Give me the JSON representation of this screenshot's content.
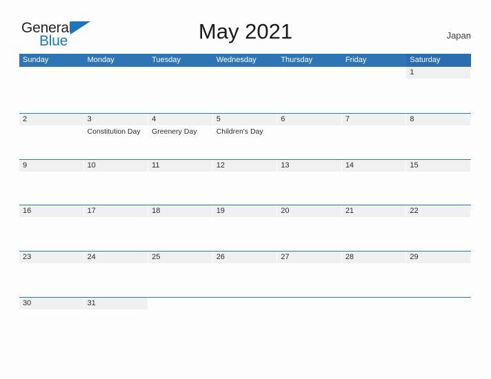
{
  "brand": {
    "word_one": "General",
    "word_two": "Blue"
  },
  "header": {
    "title": "May 2021",
    "country": "Japan"
  },
  "calendar": {
    "weekday_headers": [
      "Sunday",
      "Monday",
      "Tuesday",
      "Wednesday",
      "Thursday",
      "Friday",
      "Saturday"
    ],
    "colors": {
      "header_blue": "#2e75b6",
      "saturday_blue": "#2a6db0",
      "row_rule": "#2e75b6",
      "day_band": "#f0f0f0",
      "brand_blue": "#1c76bc"
    },
    "weeks": [
      [
        {
          "day": "",
          "event": ""
        },
        {
          "day": "",
          "event": ""
        },
        {
          "day": "",
          "event": ""
        },
        {
          "day": "",
          "event": ""
        },
        {
          "day": "",
          "event": ""
        },
        {
          "day": "",
          "event": ""
        },
        {
          "day": "1",
          "event": ""
        }
      ],
      [
        {
          "day": "2",
          "event": ""
        },
        {
          "day": "3",
          "event": "Constitution Day"
        },
        {
          "day": "4",
          "event": "Greenery Day"
        },
        {
          "day": "5",
          "event": "Children's Day"
        },
        {
          "day": "6",
          "event": ""
        },
        {
          "day": "7",
          "event": ""
        },
        {
          "day": "8",
          "event": ""
        }
      ],
      [
        {
          "day": "9",
          "event": ""
        },
        {
          "day": "10",
          "event": ""
        },
        {
          "day": "11",
          "event": ""
        },
        {
          "day": "12",
          "event": ""
        },
        {
          "day": "13",
          "event": ""
        },
        {
          "day": "14",
          "event": ""
        },
        {
          "day": "15",
          "event": ""
        }
      ],
      [
        {
          "day": "16",
          "event": ""
        },
        {
          "day": "17",
          "event": ""
        },
        {
          "day": "18",
          "event": ""
        },
        {
          "day": "19",
          "event": ""
        },
        {
          "day": "20",
          "event": ""
        },
        {
          "day": "21",
          "event": ""
        },
        {
          "day": "22",
          "event": ""
        }
      ],
      [
        {
          "day": "23",
          "event": ""
        },
        {
          "day": "24",
          "event": ""
        },
        {
          "day": "25",
          "event": ""
        },
        {
          "day": "26",
          "event": ""
        },
        {
          "day": "27",
          "event": ""
        },
        {
          "day": "28",
          "event": ""
        },
        {
          "day": "29",
          "event": ""
        }
      ],
      [
        {
          "day": "30",
          "event": ""
        },
        {
          "day": "31",
          "event": ""
        },
        {
          "day": "",
          "event": ""
        },
        {
          "day": "",
          "event": ""
        },
        {
          "day": "",
          "event": ""
        },
        {
          "day": "",
          "event": ""
        },
        {
          "day": "",
          "event": ""
        }
      ]
    ]
  }
}
